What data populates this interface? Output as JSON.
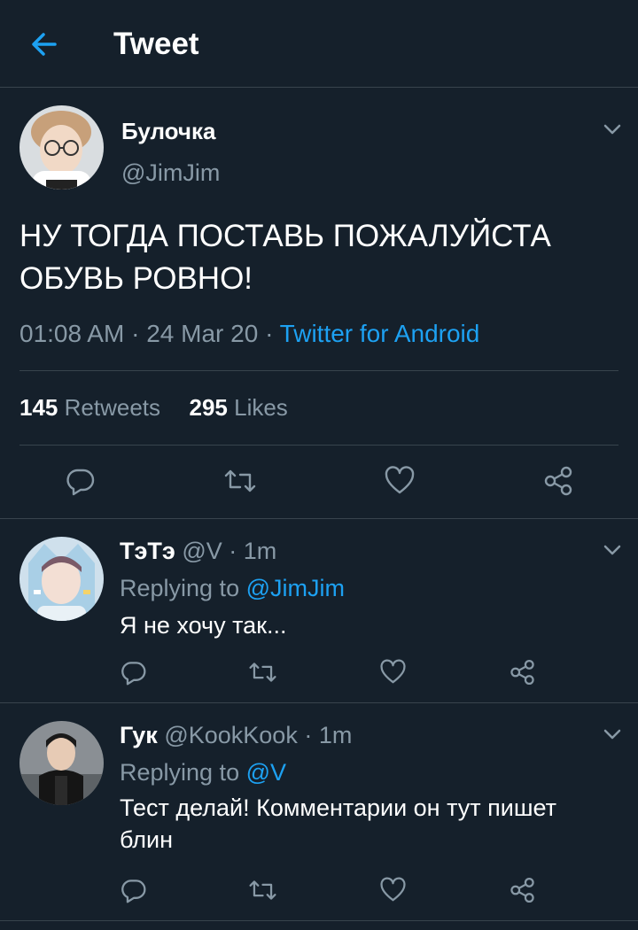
{
  "header": {
    "title": "Tweet"
  },
  "main_tweet": {
    "display_name": "Булочка",
    "handle": "@JimJim",
    "text": "НУ ТОГДА ПОСТАВЬ ПОЖАЛУЙСТА ОБУВЬ РОВНО!",
    "time": "01:08 AM",
    "date": "24 Mar 20",
    "source": "Twitter for Android",
    "retweets_count": "145",
    "retweets_label": "Retweets",
    "likes_count": "295",
    "likes_label": "Likes"
  },
  "replies": [
    {
      "display_name": "ТэТэ",
      "handle": "@V",
      "time": "1m",
      "replying_label": "Replying to",
      "replying_to": "@JimJim",
      "text": "Я не хочу так..."
    },
    {
      "display_name": "Гук",
      "handle": "@KookKook",
      "time": "1m",
      "replying_label": "Replying to",
      "replying_to": "@V",
      "text": "Тест делай! Комментарии он тут пишет блин"
    }
  ],
  "colors": {
    "background": "#15202b",
    "divider": "#38444d",
    "secondary_text": "#8899a6",
    "accent": "#1da1f2"
  }
}
